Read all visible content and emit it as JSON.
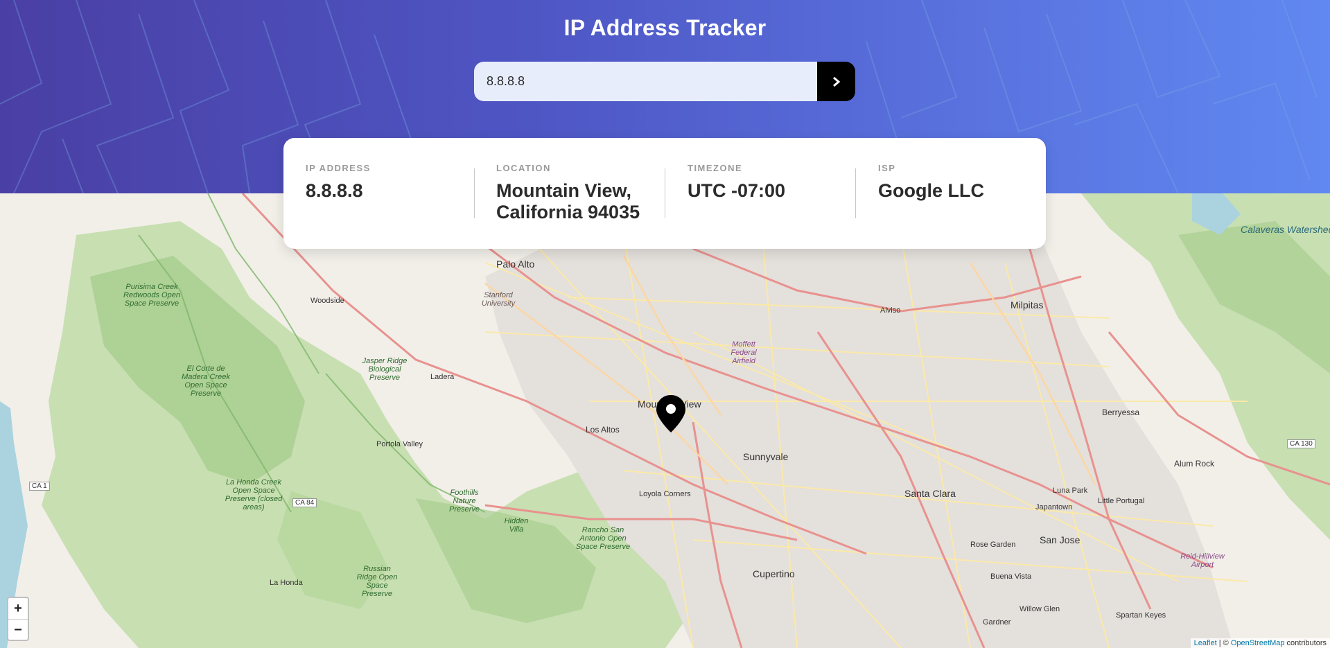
{
  "header": {
    "title": "IP Address Tracker",
    "search_value": "8.8.8.8",
    "search_button_icon": "chevron-right-icon"
  },
  "info": {
    "ip_label": "IP ADDRESS",
    "ip_value": "8.8.8.8",
    "location_label": "LOCATION",
    "location_value": "Mountain View, California 94035",
    "timezone_label": "TIMEZONE",
    "timezone_value": "UTC -07:00",
    "isp_label": "ISP",
    "isp_value": "Google LLC"
  },
  "map": {
    "zoom_in": "+",
    "zoom_out": "−",
    "attribution_leaflet": "Leaflet",
    "attribution_sep": " | © ",
    "attribution_osm": "OpenStreetMap",
    "attribution_suffix": " contributors",
    "labels": {
      "palo_alto": "Palo Alto",
      "mountain_view": "Mountain View",
      "los_altos": "Los Altos",
      "sunnyvale": "Sunnyvale",
      "santa_clara": "Santa Clara",
      "san_jose": "San Jose",
      "cupertino": "Cupertino",
      "milpitas": "Milpitas",
      "berryessa": "Berryessa",
      "alum_rock": "Alum Rock",
      "loyola_corners": "Loyola Corners",
      "portola_valley": "Portola Valley",
      "la_honda": "La Honda",
      "woodside": "Woodside",
      "ladera": "Ladera",
      "alviso": "Alviso",
      "luna_park": "Luna Park",
      "japantown": "Japantown",
      "rose_garden": "Rose Garden",
      "buena_vista": "Buena Vista",
      "willow_glen": "Willow Glen",
      "gardner": "Gardner",
      "spartan_keyes": "Spartan Keyes",
      "little_portugal": "Little Portugal",
      "calaveras": "Calaveras Watershed",
      "moffett": "Moffett Federal Airfield",
      "purisima": "Purisima Creek Redwoods Open Space Preserve",
      "la_honda_preserve": "La Honda Creek Open Space Preserve (closed areas)",
      "el_corte": "El Corte de Madera Creek Open Space Preserve",
      "jasper": "Jasper Ridge Biological Preserve",
      "rancho_san_antonio": "Rancho San Antonio Open Space Preserve",
      "foothills": "Foothills Nature Preserve",
      "hidden_villa": "Hidden Villa",
      "russian_ridge": "Russian Ridge Open Space Preserve",
      "stanford": "Stanford University",
      "reid_hillview": "Reid-Hillview Airport",
      "ca1": "CA 1",
      "ca84": "CA 84",
      "ca130": "CA 130"
    }
  }
}
